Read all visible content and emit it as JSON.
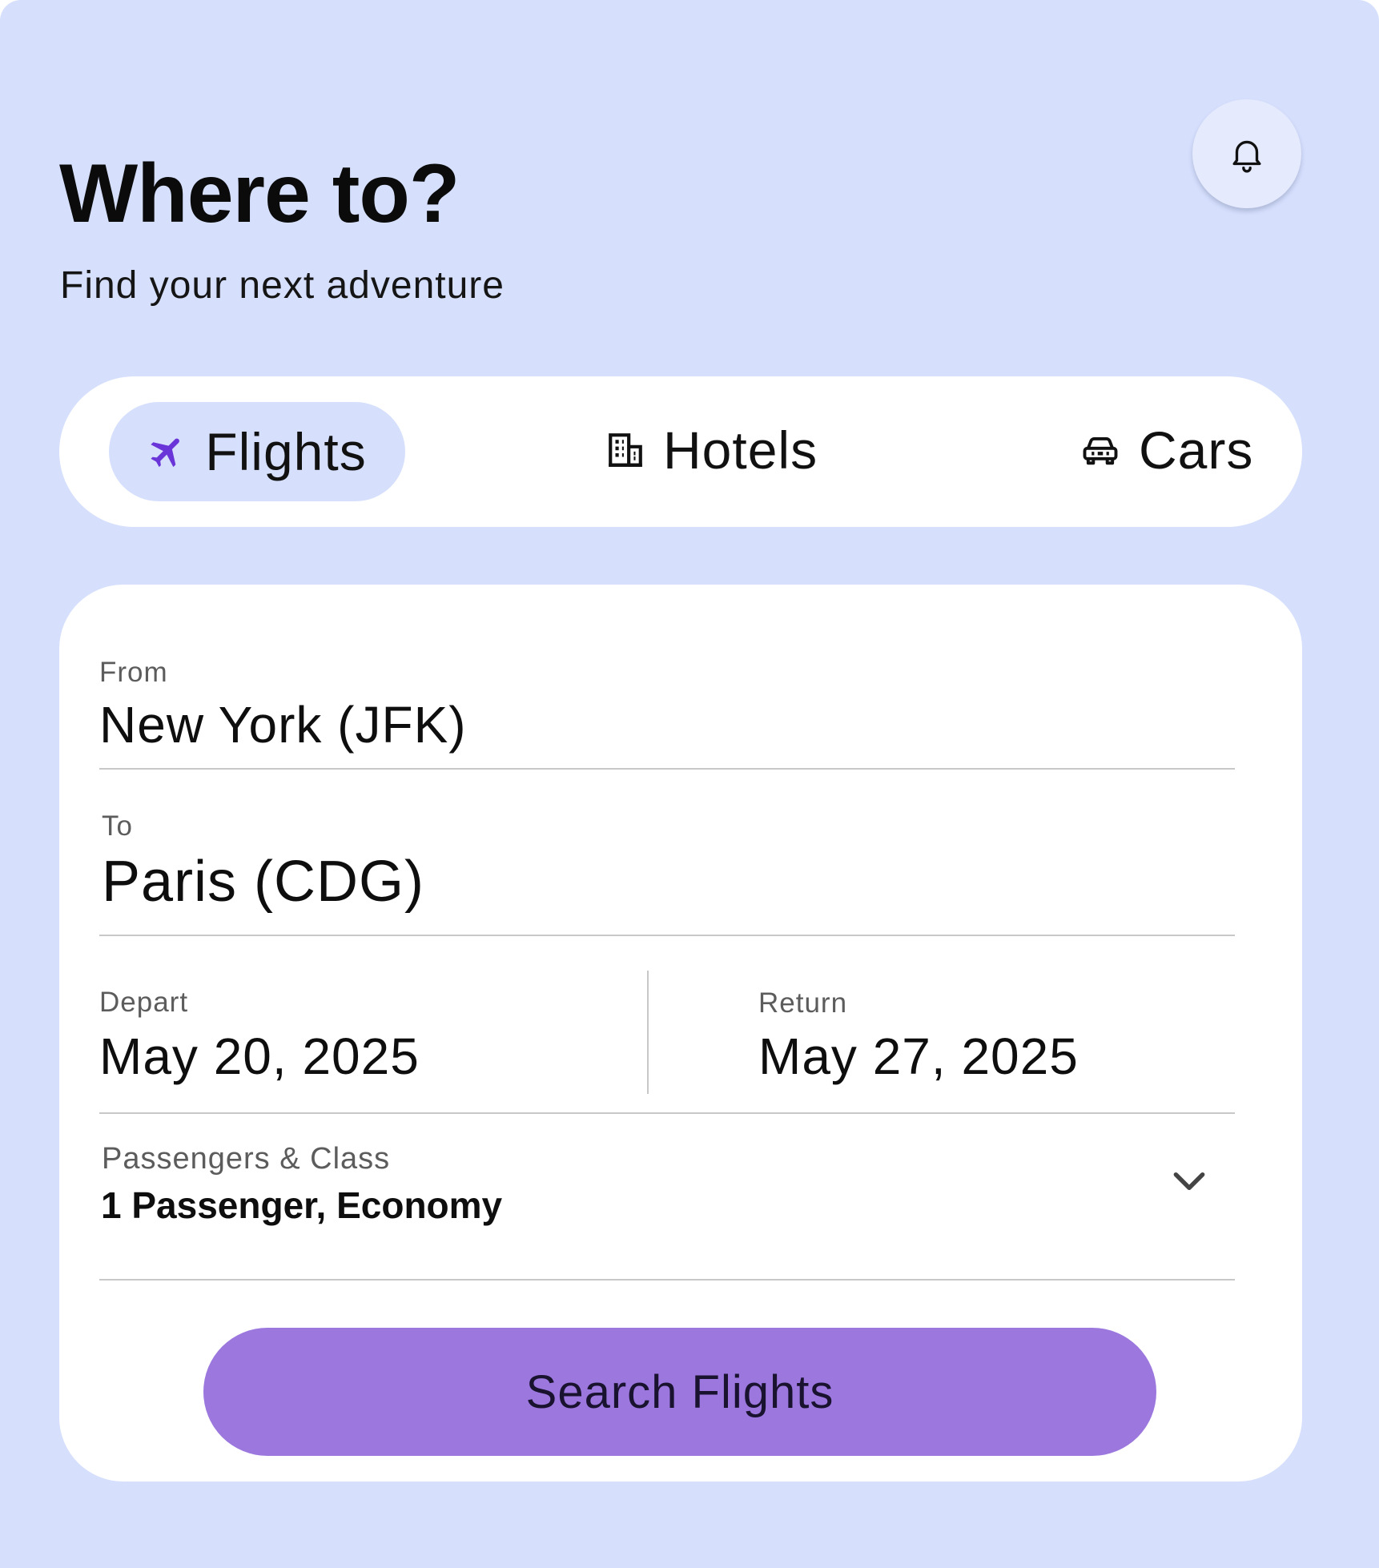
{
  "header": {
    "title": "Where to?",
    "subtitle": "Find your next adventure"
  },
  "notifications": {
    "icon": "bell-icon"
  },
  "tabs": [
    {
      "label": "Flights",
      "icon": "plane-icon",
      "active": true
    },
    {
      "label": "Hotels",
      "icon": "building-icon",
      "active": false
    },
    {
      "label": "Cars",
      "icon": "car-icon",
      "active": false
    }
  ],
  "form": {
    "from": {
      "label": "From",
      "value": "New York (JFK)"
    },
    "to": {
      "label": "To",
      "value": "Paris (CDG)"
    },
    "depart": {
      "label": "Depart",
      "value": "May 20, 2025"
    },
    "return": {
      "label": "Return",
      "value": "May 27, 2025"
    },
    "passengers": {
      "label": "Passengers & Class",
      "value": "1 Passenger, Economy",
      "icon": "chevron-down-icon"
    }
  },
  "search_button": {
    "label": "Search Flights"
  },
  "colors": {
    "background": "#d6e0fd",
    "surface": "#ffffff",
    "accent": "#9b77de",
    "plane_icon": "#6a35d8"
  }
}
